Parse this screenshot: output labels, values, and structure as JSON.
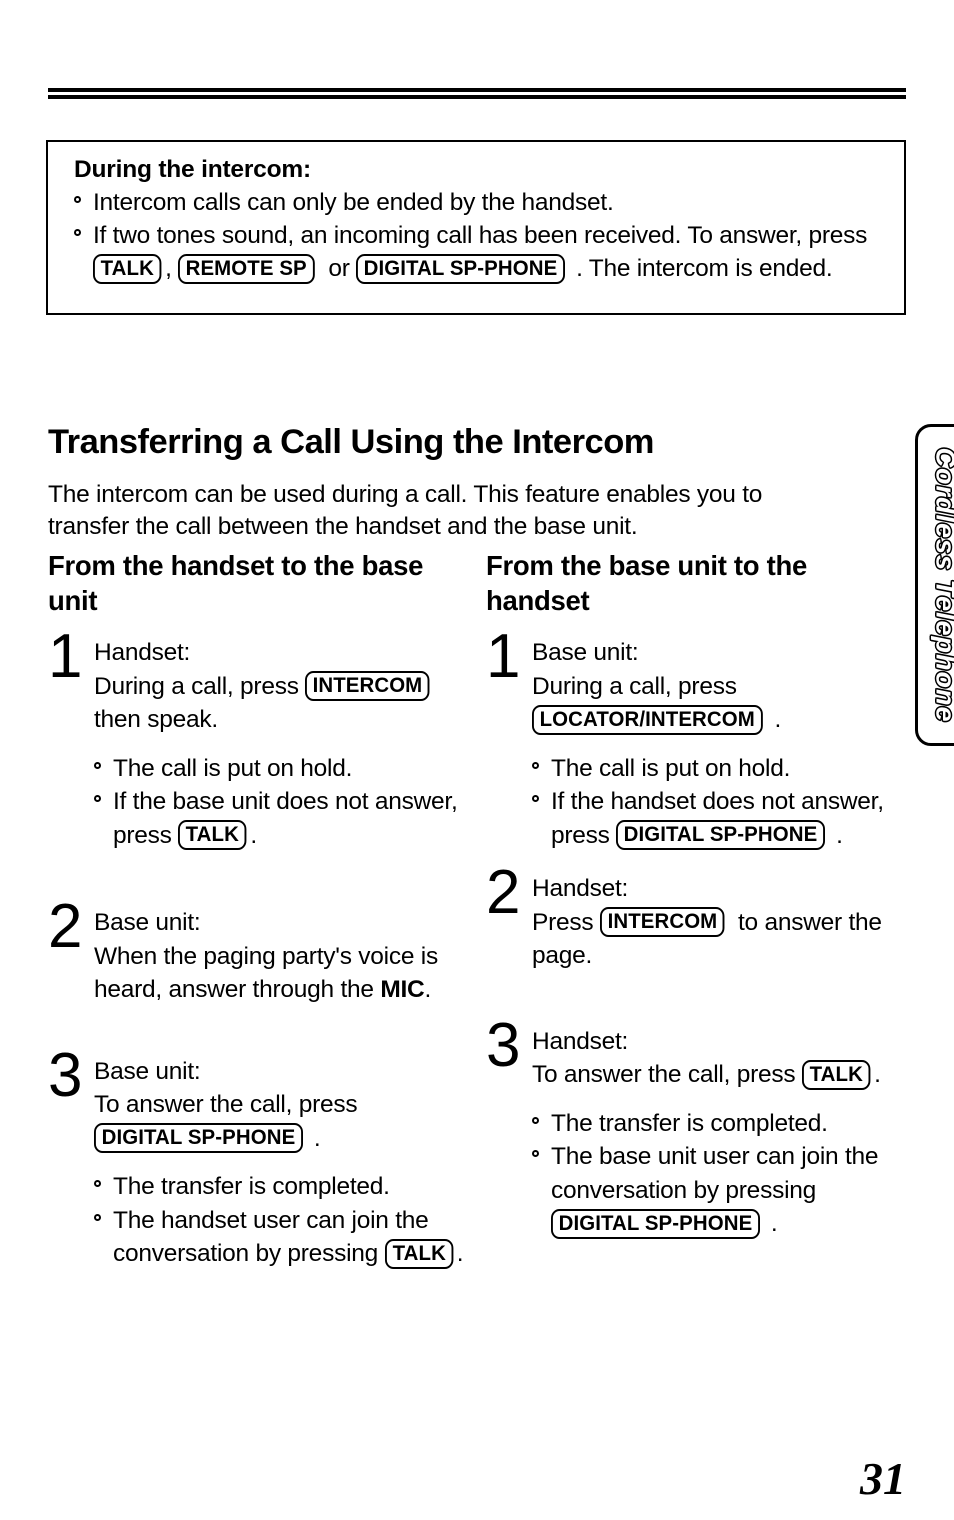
{
  "note_box": {
    "title": "During the intercom:",
    "items": [
      {
        "segments": [
          {
            "type": "text",
            "value": "Intercom calls can only be ended by the handset."
          }
        ]
      },
      {
        "segments": [
          {
            "type": "text",
            "value": "If two tones sound, an incoming call has been received. To answer, press "
          },
          {
            "type": "key",
            "value": "TALK"
          },
          {
            "type": "text",
            "value": ", "
          },
          {
            "type": "key",
            "value": "REMOTE SP"
          },
          {
            "type": "text",
            "value": " or "
          },
          {
            "type": "key",
            "value": "DIGITAL SP-PHONE"
          },
          {
            "type": "text",
            "value": ". The intercom is ended."
          }
        ]
      }
    ]
  },
  "main": {
    "heading": "Transferring a Call Using the Intercom",
    "intro": "The intercom can be used during a call. This feature enables you to transfer the call between the handset and the base unit."
  },
  "left_column": {
    "heading": "From the handset to the base unit",
    "steps": [
      {
        "number": "1",
        "role": "Handset:",
        "instruction_segments": [
          {
            "type": "text",
            "value": "During a call, press "
          },
          {
            "type": "key",
            "value": "INTERCOM"
          },
          {
            "type": "text",
            "value": " then speak."
          }
        ],
        "notes": [
          {
            "segments": [
              {
                "type": "text",
                "value": "The call is put on hold."
              }
            ]
          },
          {
            "segments": [
              {
                "type": "text",
                "value": "If the base unit does not answer, press "
              },
              {
                "type": "key",
                "value": "TALK"
              },
              {
                "type": "text",
                "value": "."
              }
            ]
          }
        ]
      },
      {
        "number": "2",
        "role": "Base unit:",
        "instruction_segments": [
          {
            "type": "text",
            "value": "When the paging party's voice is heard, answer through the "
          },
          {
            "type": "bold",
            "value": "MIC"
          },
          {
            "type": "text",
            "value": "."
          }
        ],
        "notes": []
      },
      {
        "number": "3",
        "role": "Base unit:",
        "instruction_segments": [
          {
            "type": "text",
            "value": "To answer the call, press "
          },
          {
            "type": "key",
            "value": "DIGITAL SP-PHONE"
          },
          {
            "type": "text",
            "value": "."
          }
        ],
        "notes": [
          {
            "segments": [
              {
                "type": "text",
                "value": "The transfer is completed."
              }
            ]
          },
          {
            "segments": [
              {
                "type": "text",
                "value": "The handset user can join the conversation by pressing "
              },
              {
                "type": "key",
                "value": "TALK"
              },
              {
                "type": "text",
                "value": "."
              }
            ]
          }
        ]
      }
    ]
  },
  "right_column": {
    "heading": "From the base unit to the handset",
    "steps": [
      {
        "number": "1",
        "role": "Base unit:",
        "instruction_segments": [
          {
            "type": "text",
            "value": "During a call, press "
          },
          {
            "type": "key",
            "value": "LOCATOR/INTERCOM"
          },
          {
            "type": "text",
            "value": "."
          }
        ],
        "notes": [
          {
            "segments": [
              {
                "type": "text",
                "value": "The call is put on hold."
              }
            ]
          },
          {
            "segments": [
              {
                "type": "text",
                "value": "If the handset does not answer, press "
              },
              {
                "type": "key",
                "value": "DIGITAL SP-PHONE"
              },
              {
                "type": "text",
                "value": "."
              }
            ]
          }
        ]
      },
      {
        "number": "2",
        "role": "Handset:",
        "instruction_segments": [
          {
            "type": "text",
            "value": "Press "
          },
          {
            "type": "key",
            "value": "INTERCOM"
          },
          {
            "type": "text",
            "value": " to answer the page."
          }
        ],
        "notes": []
      },
      {
        "number": "3",
        "role": "Handset:",
        "instruction_segments": [
          {
            "type": "text",
            "value": "To answer the call, press "
          },
          {
            "type": "key",
            "value": "TALK"
          },
          {
            "type": "text",
            "value": "."
          }
        ],
        "notes": [
          {
            "segments": [
              {
                "type": "text",
                "value": "The transfer is completed."
              }
            ]
          },
          {
            "segments": [
              {
                "type": "text",
                "value": "The base unit user can join the conversation by pressing "
              },
              {
                "type": "key",
                "value": "DIGITAL SP-PHONE"
              },
              {
                "type": "text",
                "value": "."
              }
            ]
          }
        ]
      }
    ]
  },
  "side_tab": {
    "label": "Cordless Telephone"
  },
  "footer": {
    "page_number": "31"
  }
}
